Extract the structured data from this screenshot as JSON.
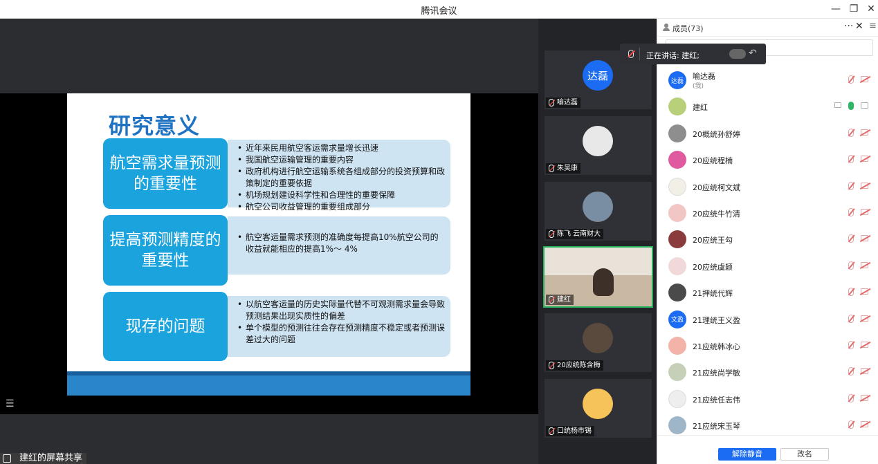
{
  "window": {
    "title": "腾讯会议"
  },
  "slide": {
    "title": "研究意义",
    "sections": [
      {
        "heading": "航空需求量预测的重要性",
        "bullets": [
          "近年来民用航空客运需求量增长迅速",
          "我国航空运输管理的重要内容",
          "政府机构进行航空运输系统各组成部分的投资预算和政策制定的重要依据",
          "机场规划建设科学性和合理性的重要保障",
          "航空公司收益管理的重要组成部分"
        ]
      },
      {
        "heading": "提高预测精度的重要性",
        "bullets": [
          "航空客运量需求预测的准确度每提高10%航空公司的收益就能相应的提高1%～ 4%"
        ]
      },
      {
        "heading": "现存的问题",
        "bullets": [
          "以航空客运量的历史实际量代替不可观测需求量会导致预测结果出现实质性的偏差",
          "单个模型的预测往往会存在预测精度不稳定或者预测误差过大的问题"
        ]
      }
    ]
  },
  "share_label": "建红的屏幕共享",
  "videos": [
    {
      "name": "喻达磊",
      "avatar_text": "达磊",
      "color": "#1b6cf2"
    },
    {
      "name": "朱吴康",
      "avatar_text": "",
      "color": "#e8e8e8"
    },
    {
      "name": "陈飞   云南财大",
      "avatar_text": "",
      "color": "#7a8ea3"
    },
    {
      "name": "建红",
      "avatar_text": "",
      "color": "#c9b9a3"
    },
    {
      "name": "20应统陈含梅",
      "avatar_text": "",
      "color": "#5a4a3d"
    },
    {
      "name": "口统杨市锡",
      "avatar_text": "",
      "color": "#f6c35a"
    }
  ],
  "tooltip": {
    "speaking": "正在讲话: 建红;"
  },
  "panel": {
    "title": "成员(73)",
    "members": [
      {
        "name": "喻达磊",
        "sub": "(我)",
        "avatar_text": "达磊",
        "color": "#1b6cf2",
        "mic": "off",
        "cam": "off"
      },
      {
        "name": "建红",
        "sub": "",
        "avatar_text": "",
        "color": "#b8d07a",
        "mic": "on",
        "cam": "on",
        "screen": true
      },
      {
        "name": "20概统孙舒婷",
        "sub": "",
        "avatar_text": "",
        "color": "#8e8e8e",
        "mic": "off",
        "cam": "off"
      },
      {
        "name": "20应统程楠",
        "sub": "",
        "avatar_text": "",
        "color": "#e05aa0",
        "mic": "off",
        "cam": "off"
      },
      {
        "name": "20应统柯文斌",
        "sub": "",
        "avatar_text": "",
        "color": "#f2efe6",
        "mic": "off",
        "cam": "off"
      },
      {
        "name": "20应统牛竹清",
        "sub": "",
        "avatar_text": "",
        "color": "#f3c6c6",
        "mic": "off",
        "cam": "off"
      },
      {
        "name": "20应统王勾",
        "sub": "",
        "avatar_text": "",
        "color": "#8a3b3b",
        "mic": "off",
        "cam": "off"
      },
      {
        "name": "20应统虞颖",
        "sub": "",
        "avatar_text": "",
        "color": "#f1d9d9",
        "mic": "off",
        "cam": "off"
      },
      {
        "name": "21押统代辉",
        "sub": "",
        "avatar_text": "",
        "color": "#4a4a4a",
        "mic": "off",
        "cam": "off"
      },
      {
        "name": "21理统王义盈",
        "sub": "",
        "avatar_text": "文盈",
        "color": "#1b6cf2",
        "mic": "off",
        "cam": "off"
      },
      {
        "name": "21应统韩冰心",
        "sub": "",
        "avatar_text": "",
        "color": "#f3b3a8",
        "mic": "off",
        "cam": "off"
      },
      {
        "name": "21应统尚学敏",
        "sub": "",
        "avatar_text": "",
        "color": "#c6d0b8",
        "mic": "off",
        "cam": "off"
      },
      {
        "name": "21应统任志伟",
        "sub": "",
        "avatar_text": "",
        "color": "#eeeeee",
        "mic": "off",
        "cam": "off"
      },
      {
        "name": "21应统宋玉琴",
        "sub": "",
        "avatar_text": "",
        "color": "#9fb6c9",
        "mic": "off",
        "cam": "off"
      }
    ],
    "unmute_label": "解除静音",
    "rename_label": "改名"
  }
}
